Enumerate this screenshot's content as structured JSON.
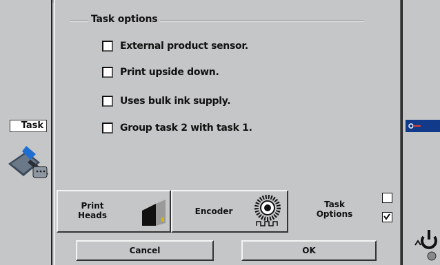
{
  "background": {
    "task_label": "Task"
  },
  "dialog": {
    "group_title": "Task options",
    "options": [
      {
        "label": "External product sensor.",
        "checked": false
      },
      {
        "label": "Print upside down.",
        "checked": false
      },
      {
        "label": "Uses bulk ink supply.",
        "checked": false
      },
      {
        "label": "Group task 2 with task 1.",
        "checked": false
      }
    ],
    "tabs": {
      "print_heads_line1": "Print",
      "print_heads_line2": "Heads",
      "encoder": "Encoder",
      "task_options_line1": "Task",
      "task_options_line2": "Options",
      "task_options_toggle1_checked": false,
      "task_options_toggle2_checked": true
    },
    "buttons": {
      "cancel": "Cancel",
      "ok": "OK"
    }
  },
  "colors": {
    "panel": "#c4c6c8",
    "accent_blue": "#123a8a"
  }
}
